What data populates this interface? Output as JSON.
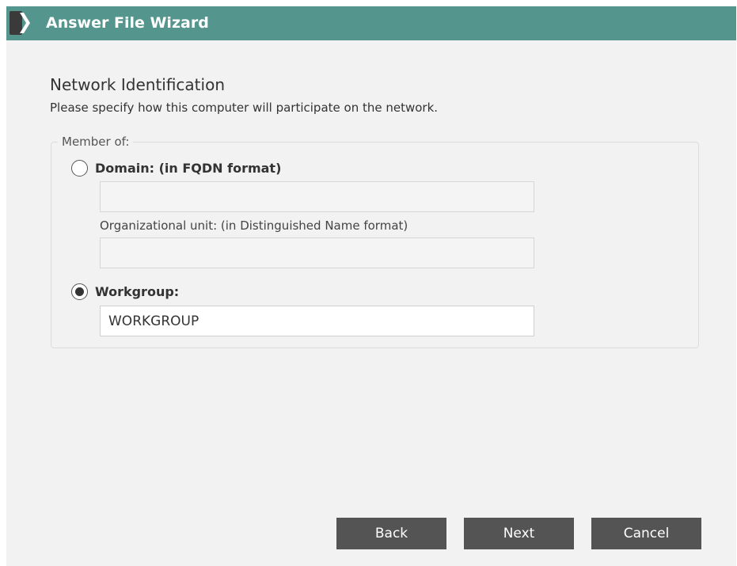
{
  "window": {
    "title": "Answer File Wizard",
    "accent_color": "#54958d",
    "logo_icon": "chevron-right-logo-icon"
  },
  "page": {
    "heading": "Network Identification",
    "subtitle": "Please specify how this computer will participate on the network."
  },
  "member_of": {
    "legend": "Member of:",
    "domain": {
      "label": "Domain: (in FQDN format)",
      "selected": false,
      "value": "",
      "ou_label": "Organizational unit: (in Distinguished Name format)",
      "ou_value": ""
    },
    "workgroup": {
      "label": "Workgroup:",
      "selected": true,
      "value": "WORKGROUP"
    }
  },
  "buttons": {
    "back": "Back",
    "next": "Next",
    "cancel": "Cancel"
  }
}
